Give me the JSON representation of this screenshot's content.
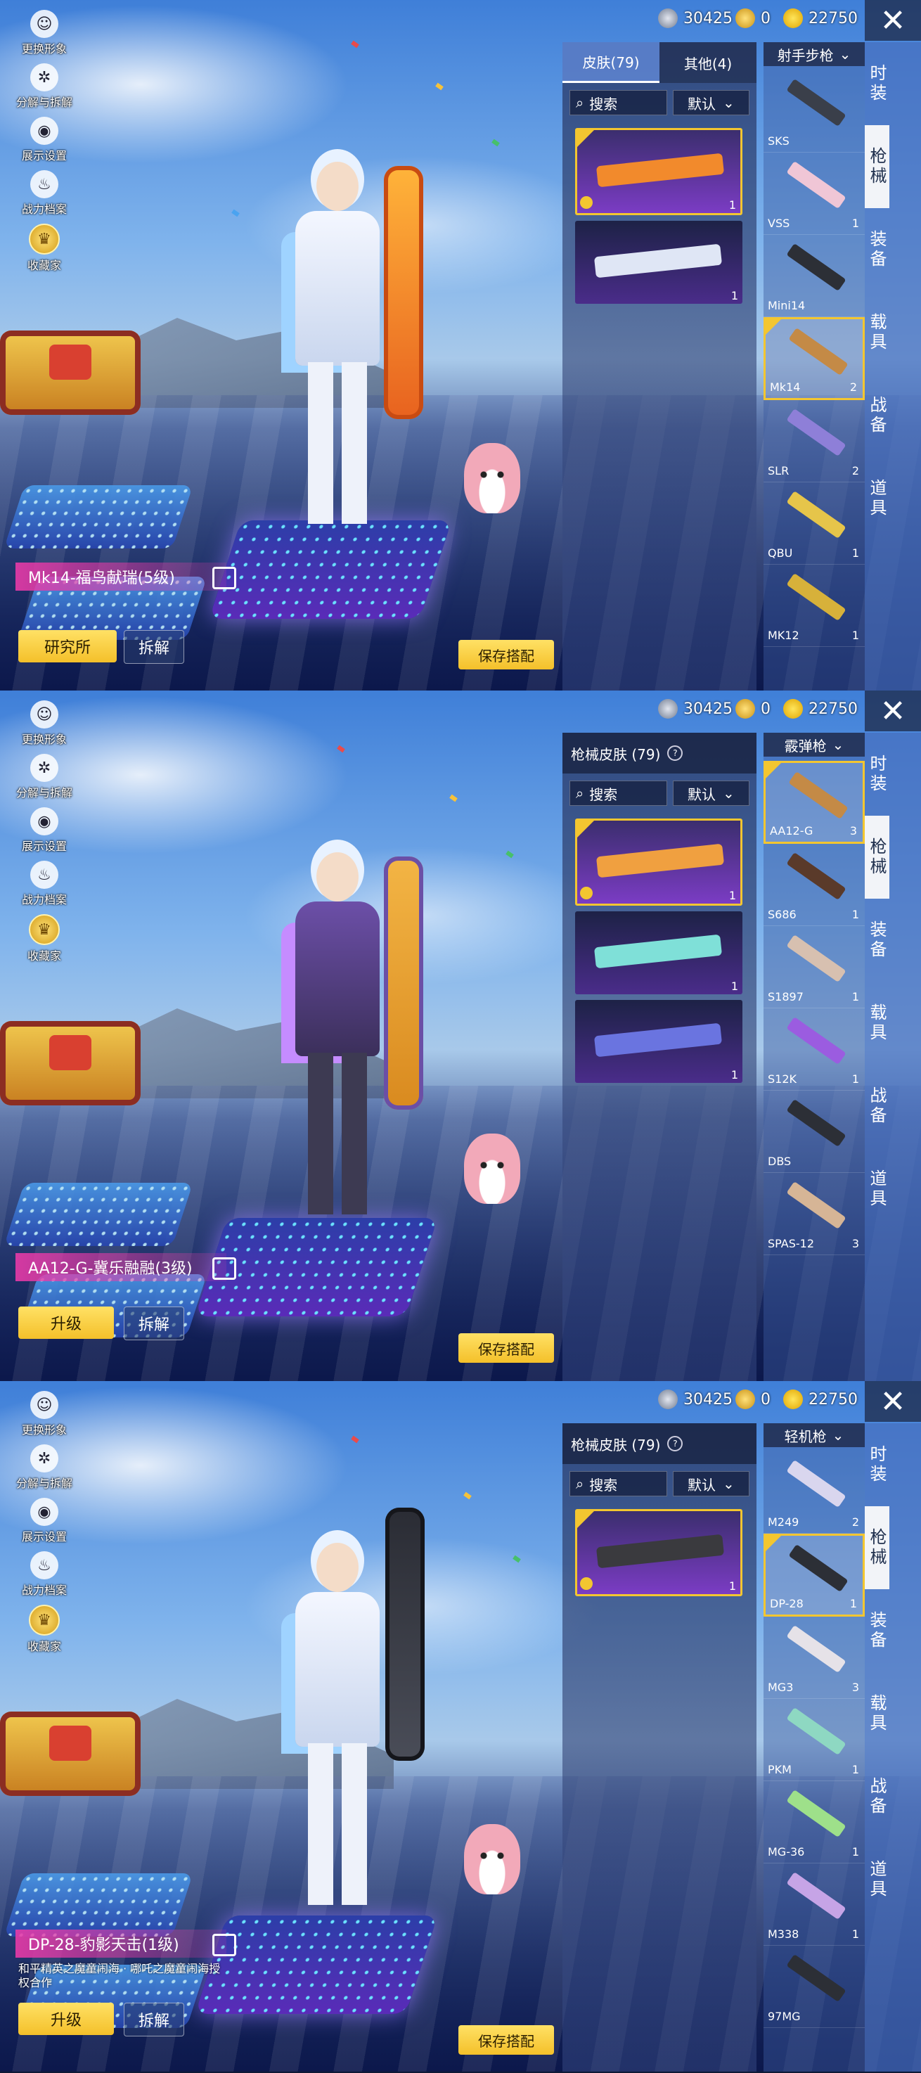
{
  "common": {
    "left_menu": [
      "更换形象",
      "分解与拆解",
      "展示设置",
      "战力档案",
      "收藏家"
    ],
    "currency": {
      "silver": "30425",
      "coupon": "0",
      "uc": "22750"
    },
    "categories": [
      "时装",
      "枪械",
      "装备",
      "载具",
      "战备",
      "道具"
    ],
    "save_label": "保存搭配",
    "dismantle_label": "拆解",
    "search_label": "搜索",
    "sort_label": "默认"
  },
  "screens": [
    {
      "header_tabs": [
        "皮肤(79)",
        "其他(4)"
      ],
      "weapon_type": "射手步枪",
      "skin_name": "Mk14-福鸟献瑞(5级)",
      "primary_button": "研究所",
      "skins": [
        {
          "count": "1",
          "selected": true,
          "color": "#f28a2c"
        },
        {
          "count": "1",
          "selected": false,
          "color": "#dfe6f5"
        }
      ],
      "weapons": [
        {
          "name": "SKS",
          "count": "",
          "selected": false
        },
        {
          "name": "VSS",
          "count": "1",
          "selected": false
        },
        {
          "name": "Mini14",
          "count": "",
          "selected": false
        },
        {
          "name": "Mk14",
          "count": "2",
          "selected": true
        },
        {
          "name": "SLR",
          "count": "2",
          "selected": false
        },
        {
          "name": "QBU",
          "count": "1",
          "selected": false
        },
        {
          "name": "MK12",
          "count": "1",
          "selected": false
        }
      ]
    },
    {
      "skin_title": "枪械皮肤 (79)",
      "weapon_type": "霰弹枪",
      "skin_name": "AA12-G-冀乐融融(3级)",
      "primary_button": "升级",
      "skins": [
        {
          "count": "1",
          "selected": true,
          "color": "#f0a040"
        },
        {
          "count": "1",
          "selected": false,
          "color": "#7fe0d8"
        },
        {
          "count": "1",
          "selected": false,
          "color": "#6a74e0"
        }
      ],
      "weapons": [
        {
          "name": "AA12-G",
          "count": "3",
          "selected": true
        },
        {
          "name": "S686",
          "count": "1",
          "selected": false
        },
        {
          "name": "S1897",
          "count": "1",
          "selected": false
        },
        {
          "name": "S12K",
          "count": "1",
          "selected": false
        },
        {
          "name": "DBS",
          "count": "",
          "selected": false
        },
        {
          "name": "SPAS-12",
          "count": "3",
          "selected": false
        }
      ]
    },
    {
      "skin_title": "枪械皮肤 (79)",
      "weapon_type": "轻机枪",
      "skin_name": "DP-28-豹影天击(1级)",
      "sub_caption": "和平精英之魔童闹海 · 哪吒之魔童闹海授权合作",
      "primary_button": "升级",
      "skins": [
        {
          "count": "1",
          "selected": true,
          "color": "#3a3a3e"
        }
      ],
      "weapons": [
        {
          "name": "M249",
          "count": "2",
          "selected": false
        },
        {
          "name": "DP-28",
          "count": "1",
          "selected": true
        },
        {
          "name": "MG3",
          "count": "3",
          "selected": false
        },
        {
          "name": "PKM",
          "count": "1",
          "selected": false
        },
        {
          "name": "MG-36",
          "count": "1",
          "selected": false
        },
        {
          "name": "M338",
          "count": "1",
          "selected": false
        },
        {
          "name": "97MG",
          "count": "",
          "selected": false
        }
      ]
    }
  ]
}
